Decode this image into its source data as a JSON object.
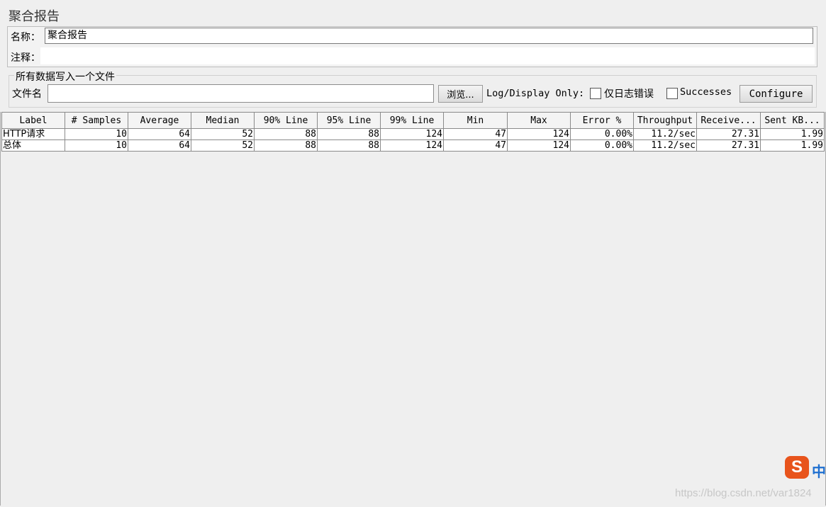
{
  "panel": {
    "title": "聚合报告",
    "name_label": "名称：",
    "name_value": "聚合报告",
    "comment_label": "注释："
  },
  "file_section": {
    "legend": "所有数据写入一个文件",
    "file_label": "文件名",
    "file_value": "",
    "browse_button": "浏览...",
    "log_display_label": "Log/Display Only:",
    "errors_checkbox_label": "仅日志错误",
    "successes_checkbox_label": "Successes",
    "configure_button": "Configure"
  },
  "table": {
    "headers": [
      "Label",
      "# Samples",
      "Average",
      "Median",
      "90% Line",
      "95% Line",
      "99% Line",
      "Min",
      "Max",
      "Error %",
      "Throughput",
      "Receive...",
      "Sent KB..."
    ],
    "rows": [
      [
        "HTTP请求",
        "10",
        "64",
        "52",
        "88",
        "88",
        "124",
        "47",
        "124",
        "0.00%",
        "11.2/sec",
        "27.31",
        "1.99"
      ],
      [
        "总体",
        "10",
        "64",
        "52",
        "88",
        "88",
        "124",
        "47",
        "124",
        "0.00%",
        "11.2/sec",
        "27.31",
        "1.99"
      ]
    ]
  },
  "overlay": {
    "ime_icon": "S",
    "ime_text": "中",
    "watermark": "https://blog.csdn.net/var1824"
  }
}
